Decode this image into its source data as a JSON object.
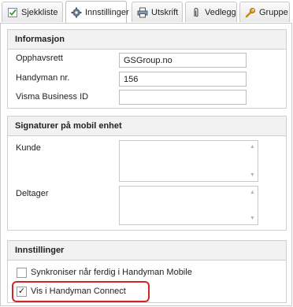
{
  "tabs": [
    {
      "label": "Sjekkliste",
      "icon": "checklist-icon",
      "active": false
    },
    {
      "label": "Innstillinger",
      "icon": "gear-icon",
      "active": true
    },
    {
      "label": "Utskrift",
      "icon": "printer-icon",
      "active": false
    },
    {
      "label": "Vedlegg",
      "icon": "paperclip-icon",
      "active": false
    },
    {
      "label": "Gruppe",
      "icon": "wrench-icon",
      "active": false
    }
  ],
  "informasjon": {
    "header": "Informasjon",
    "fields": [
      {
        "label": "Opphavsrett",
        "value": "GSGroup.no"
      },
      {
        "label": "Handyman nr.",
        "value": "156"
      },
      {
        "label": "Visma Business ID",
        "value": ""
      }
    ]
  },
  "signaturer": {
    "header": "Signaturer på mobil enhet",
    "kunde_label": "Kunde",
    "deltager_label": "Deltager"
  },
  "innstillinger": {
    "header": "Innstillinger",
    "options": [
      {
        "label": "Synkroniser når ferdig i Handyman Mobile",
        "checked": false
      },
      {
        "label": "Vis i Handyman Connect",
        "checked": true
      }
    ]
  },
  "colors": {
    "highlight": "#d42424",
    "header_bg": "#f2f2f2"
  }
}
